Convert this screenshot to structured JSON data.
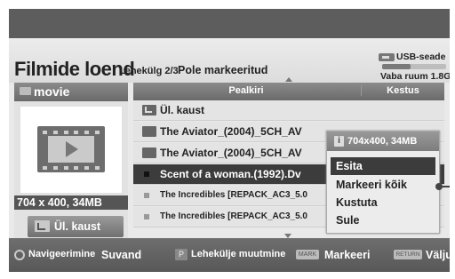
{
  "header": {
    "title": "Filmide loend",
    "page_info": "Lehekülg 2/3",
    "mark_status": "Pole markeeritud"
  },
  "usb": {
    "label": "USB-seade",
    "free_space": "Vaba ruum 1.8GB",
    "used_fraction": 0.45
  },
  "left_panel": {
    "folder_name": "movie",
    "preview_resolution": "704 x 400, 34MB",
    "up_folder_label": "Ül. kaust"
  },
  "file_list": {
    "column_name": "Pealkiri",
    "column_duration": "Kestus",
    "rows": [
      {
        "type": "up-folder",
        "label": "Ül. kaust"
      },
      {
        "type": "folder",
        "label": "The Aviator_(2004)_5CH_AV"
      },
      {
        "type": "folder",
        "label": "The Aviator_(2004)_5CH_AV"
      },
      {
        "type": "file",
        "label": "Scent of a woman.(1992).Dv",
        "selected": true
      },
      {
        "type": "file",
        "label": "The Incredibles [REPACK_AC3_5.0"
      },
      {
        "type": "file",
        "label": "The Incredibles [REPACK_AC3_5.0"
      }
    ]
  },
  "popup": {
    "info": "704x400, 34MB",
    "items": [
      "Esita",
      "Markeeri kõik",
      "Kustuta",
      "Sule"
    ],
    "active_index": 0
  },
  "footer": {
    "navigate": "Navigeerimine",
    "option": "Suvand",
    "page_change": "Lehekülje muutmine",
    "mark_key": "MARK",
    "mark": "Markeeri",
    "return_key": "RETURN",
    "exit": "Välju"
  },
  "colors": {
    "header_bg": "#e4e4e4",
    "selected_row": "#3c3c3c",
    "footer_bg": "#5f5f5f"
  }
}
